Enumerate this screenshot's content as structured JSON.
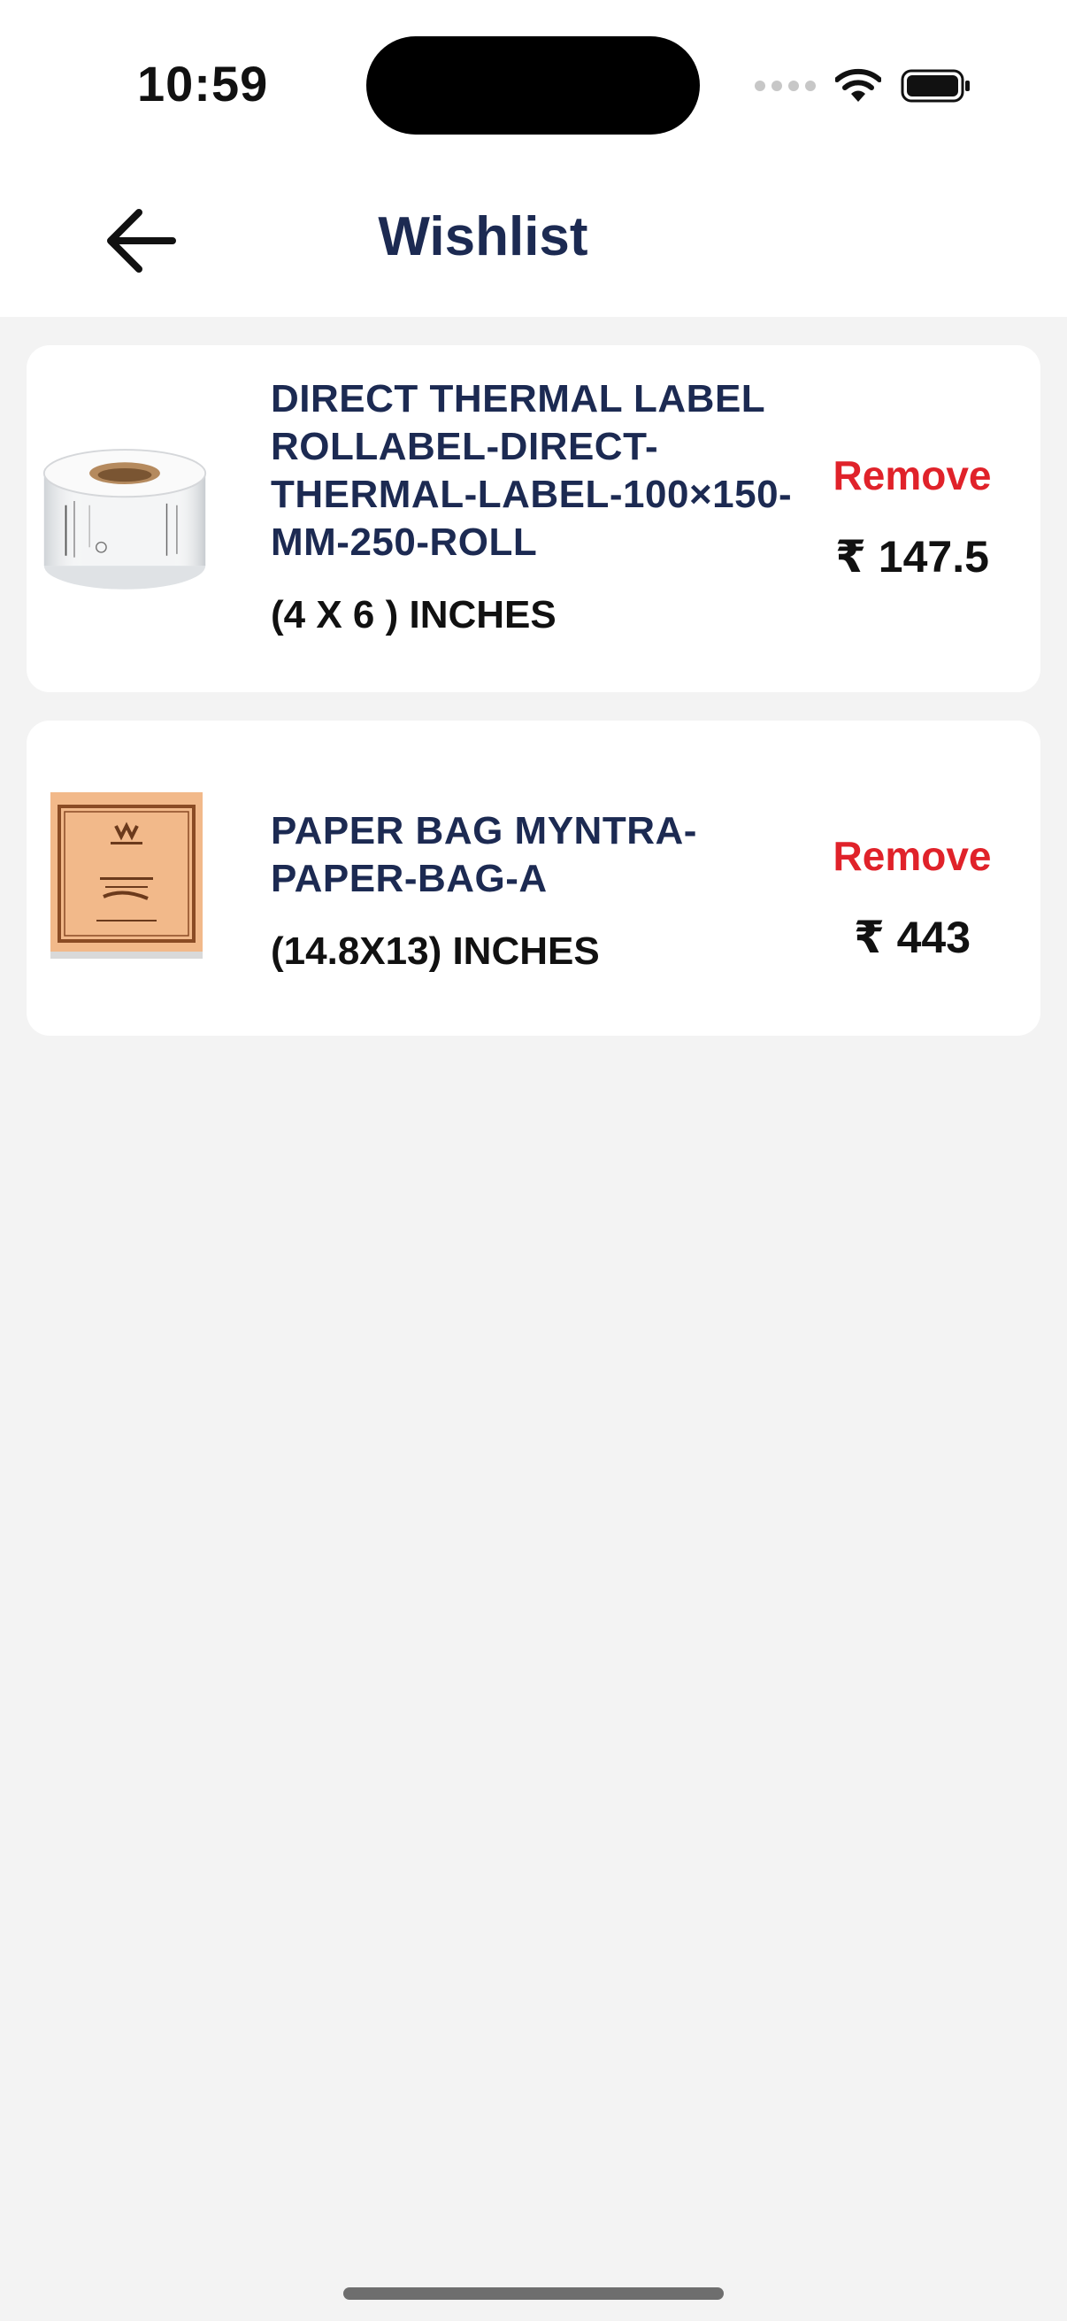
{
  "status_bar": {
    "time": "10:59"
  },
  "header": {
    "title": "Wishlist",
    "back_icon": "arrow-left-icon"
  },
  "items": [
    {
      "name": "DIRECT THERMAL LABEL  ROLLABEL-DIRECT-THERMAL-LABEL-100×150-MM-250-ROLL",
      "size": "(4 X 6 ) INCHES",
      "remove_label": "Remove",
      "price": "₹ 147.5",
      "image_icon": "label-roll-image"
    },
    {
      "name": "PAPER BAG MYNTRA-PAPER-BAG-A",
      "size": "(14.8X13) INCHES",
      "remove_label": "Remove",
      "price": "₹ 443",
      "image_icon": "paper-bag-image"
    }
  ],
  "colors": {
    "title": "#1c2a52",
    "remove": "#e0222a",
    "background": "#f3f3f3"
  }
}
